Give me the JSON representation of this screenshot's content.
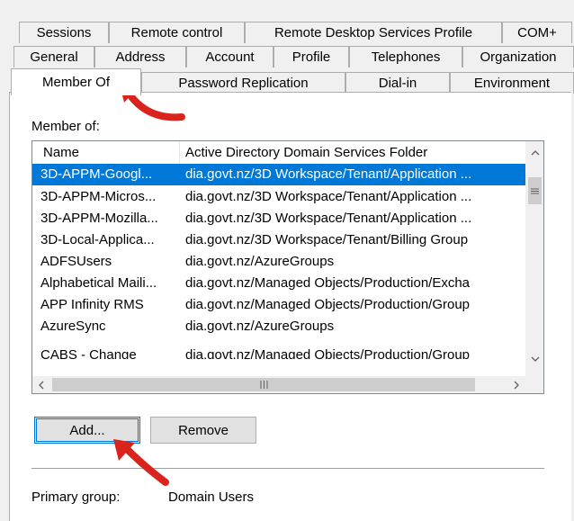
{
  "tabs": {
    "row1": [
      "Sessions",
      "Remote control",
      "Remote Desktop Services Profile",
      "COM+"
    ],
    "row2": [
      "General",
      "Address",
      "Account",
      "Profile",
      "Telephones",
      "Organization"
    ],
    "row3": [
      "Member Of",
      "Password Replication",
      "Dial-in",
      "Environment"
    ]
  },
  "member_of_label": "Member of:",
  "list": {
    "columns": [
      "Name",
      "Active Directory Domain Services Folder"
    ],
    "rows": [
      {
        "name": "3D-APPM-Googl...",
        "folder": "dia.govt.nz/3D Workspace/Tenant/Application ..."
      },
      {
        "name": "3D-APPM-Micros...",
        "folder": "dia.govt.nz/3D Workspace/Tenant/Application ..."
      },
      {
        "name": "3D-APPM-Mozilla...",
        "folder": "dia.govt.nz/3D Workspace/Tenant/Application ..."
      },
      {
        "name": "3D-Local-Applica...",
        "folder": "dia.govt.nz/3D Workspace/Tenant/Billing Group"
      },
      {
        "name": "ADFSUsers",
        "folder": "dia.govt.nz/AzureGroups"
      },
      {
        "name": "Alphabetical Maili...",
        "folder": "dia.govt.nz/Managed Objects/Production/Excha"
      },
      {
        "name": "APP Infinity RMS",
        "folder": "dia.govt.nz/Managed Objects/Production/Group"
      },
      {
        "name": "AzureSync",
        "folder": "dia.govt.nz/AzureGroups"
      },
      {
        "name": "CABS - Change",
        "folder": "dia.govt.nz/Managed Objects/Production/Group"
      }
    ],
    "selected_index": 0
  },
  "buttons": {
    "add": "Add...",
    "remove": "Remove"
  },
  "primary_group": {
    "label": "Primary group:",
    "value": "Domain Users"
  },
  "colors": {
    "selection": "#0078d7",
    "annotation": "#d9231c"
  }
}
